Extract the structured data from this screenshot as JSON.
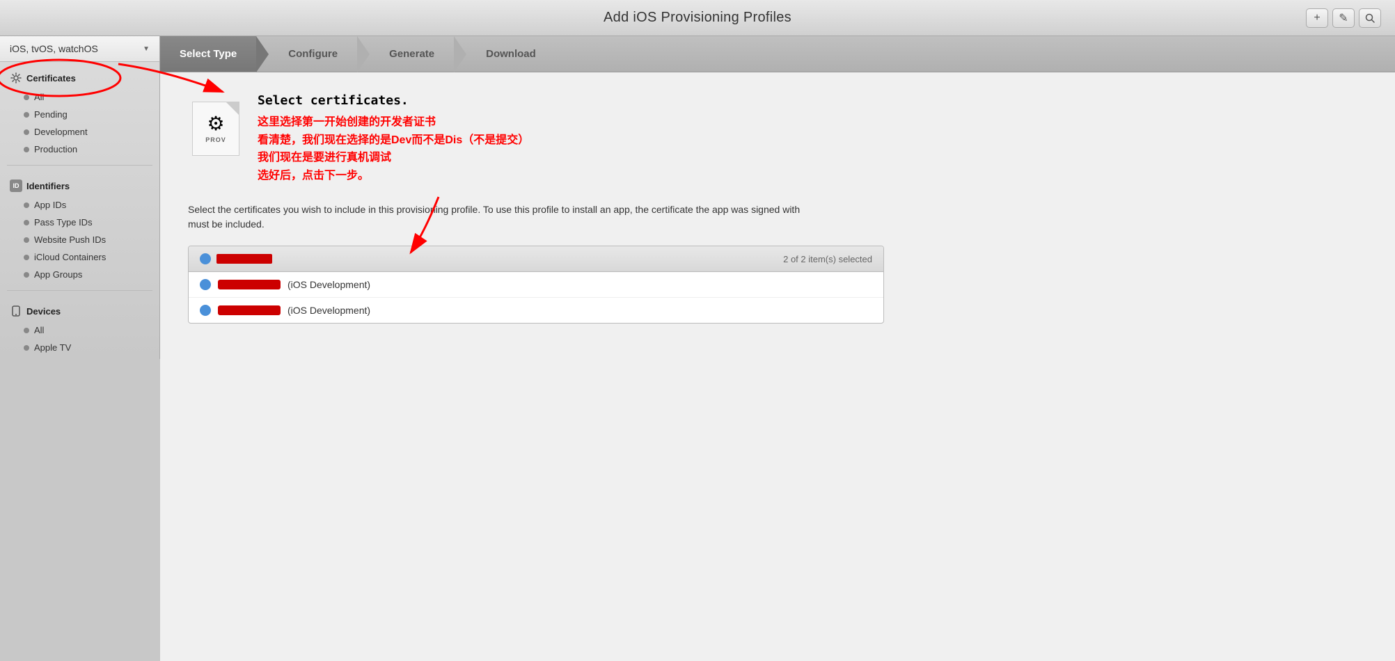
{
  "titleBar": {
    "title": "Add iOS Provisioning Profiles",
    "addBtn": "+",
    "editBtn": "✎",
    "searchBtn": "🔍"
  },
  "sidebar": {
    "dropdown": {
      "label": "iOS, tvOS, watchOS",
      "arrow": "▼"
    },
    "sections": [
      {
        "id": "certificates",
        "iconLabel": "⚙",
        "label": "Certificates",
        "items": [
          {
            "label": "All",
            "selected": false
          },
          {
            "label": "Pending",
            "selected": false
          },
          {
            "label": "Development",
            "selected": false
          },
          {
            "label": "Production",
            "selected": false
          }
        ]
      },
      {
        "id": "identifiers",
        "iconLabel": "ID",
        "label": "Identifiers",
        "items": [
          {
            "label": "App IDs",
            "selected": false
          },
          {
            "label": "Pass Type IDs",
            "selected": false
          },
          {
            "label": "Website Push IDs",
            "selected": false
          },
          {
            "label": "iCloud Containers",
            "selected": false
          },
          {
            "label": "App Groups",
            "selected": false
          }
        ]
      },
      {
        "id": "devices",
        "iconLabel": "📱",
        "label": "Devices",
        "items": [
          {
            "label": "All",
            "selected": false
          },
          {
            "label": "Apple TV",
            "selected": false
          }
        ]
      }
    ]
  },
  "steps": [
    {
      "label": "Select Type",
      "active": true
    },
    {
      "label": "Configure",
      "active": false
    },
    {
      "label": "Generate",
      "active": false
    },
    {
      "label": "Download",
      "active": false
    }
  ],
  "mainContent": {
    "provLabel": "PROV",
    "annotationTitle": "Select certificates.",
    "chineseAnnotation": "这里选择第一开始创建的开发者证书\n看清楚，我们现在选择的是Dev而不是Dis（不是提交）\n我们现在是要进行真机调试\n选好后，点击下一步。",
    "descriptionText": "Select the certificates you wish to include in this provisioning profile. To use this profile to install an app, the certificate the app was signed with must be included.",
    "certTable": {
      "headerSelectedText": "2  of 2 item(s) selected",
      "rows": [
        {
          "name": "██████████",
          "type": "(iOS Development)"
        },
        {
          "name": "██████████",
          "type": "(iOS Development)"
        }
      ]
    }
  }
}
